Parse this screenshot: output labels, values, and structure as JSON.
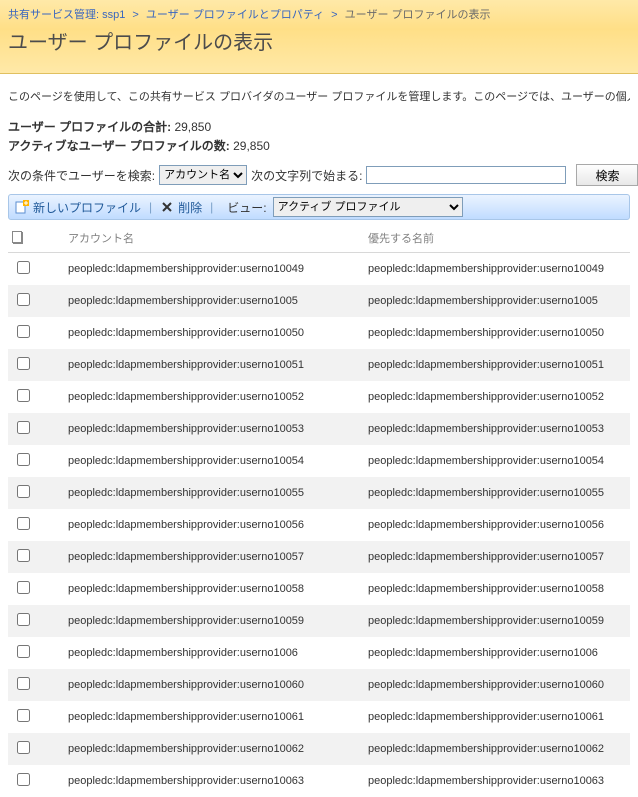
{
  "breadcrumb": {
    "items": [
      {
        "label": "共有サービス管理: ssp1"
      },
      {
        "label": "ユーザー プロファイルとプロパティ"
      }
    ],
    "current": "ユーザー プロファイルの表示",
    "sep": ">"
  },
  "page_title": "ユーザー プロファイルの表示",
  "description": "このページを使用して、この共有サービス プロバイダのユーザー プロファイルを管理します。このページでは、ユーザーの個人用サイトも管理",
  "counts": {
    "total_label": "ユーザー プロファイルの合計:",
    "total_value": "29,850",
    "active_label": "アクティブなユーザー プロファイルの数:",
    "active_value": "29,850"
  },
  "search": {
    "by_label": "次の条件でユーザーを検索:",
    "by_option": "アカウント名",
    "starts_label": "次の文字列で始まる:",
    "input_value": "",
    "button_label": "検索"
  },
  "toolbar": {
    "new_profile": "新しいプロファイル",
    "delete": "削除",
    "view_label": "ビュー:",
    "view_option": "アクティブ プロファイル"
  },
  "table": {
    "headers": {
      "account": "アカウント名",
      "preferred": "優先する名前"
    },
    "rows": [
      {
        "account": "peopledc:ldapmembershipprovider:userno10049",
        "preferred": "peopledc:ldapmembershipprovider:userno10049"
      },
      {
        "account": "peopledc:ldapmembershipprovider:userno1005",
        "preferred": "peopledc:ldapmembershipprovider:userno1005"
      },
      {
        "account": "peopledc:ldapmembershipprovider:userno10050",
        "preferred": "peopledc:ldapmembershipprovider:userno10050"
      },
      {
        "account": "peopledc:ldapmembershipprovider:userno10051",
        "preferred": "peopledc:ldapmembershipprovider:userno10051"
      },
      {
        "account": "peopledc:ldapmembershipprovider:userno10052",
        "preferred": "peopledc:ldapmembershipprovider:userno10052"
      },
      {
        "account": "peopledc:ldapmembershipprovider:userno10053",
        "preferred": "peopledc:ldapmembershipprovider:userno10053"
      },
      {
        "account": "peopledc:ldapmembershipprovider:userno10054",
        "preferred": "peopledc:ldapmembershipprovider:userno10054"
      },
      {
        "account": "peopledc:ldapmembershipprovider:userno10055",
        "preferred": "peopledc:ldapmembershipprovider:userno10055"
      },
      {
        "account": "peopledc:ldapmembershipprovider:userno10056",
        "preferred": "peopledc:ldapmembershipprovider:userno10056"
      },
      {
        "account": "peopledc:ldapmembershipprovider:userno10057",
        "preferred": "peopledc:ldapmembershipprovider:userno10057"
      },
      {
        "account": "peopledc:ldapmembershipprovider:userno10058",
        "preferred": "peopledc:ldapmembershipprovider:userno10058"
      },
      {
        "account": "peopledc:ldapmembershipprovider:userno10059",
        "preferred": "peopledc:ldapmembershipprovider:userno10059"
      },
      {
        "account": "peopledc:ldapmembershipprovider:userno1006",
        "preferred": "peopledc:ldapmembershipprovider:userno1006"
      },
      {
        "account": "peopledc:ldapmembershipprovider:userno10060",
        "preferred": "peopledc:ldapmembershipprovider:userno10060"
      },
      {
        "account": "peopledc:ldapmembershipprovider:userno10061",
        "preferred": "peopledc:ldapmembershipprovider:userno10061"
      },
      {
        "account": "peopledc:ldapmembershipprovider:userno10062",
        "preferred": "peopledc:ldapmembershipprovider:userno10062"
      },
      {
        "account": "peopledc:ldapmembershipprovider:userno10063",
        "preferred": "peopledc:ldapmembershipprovider:userno10063"
      }
    ]
  }
}
